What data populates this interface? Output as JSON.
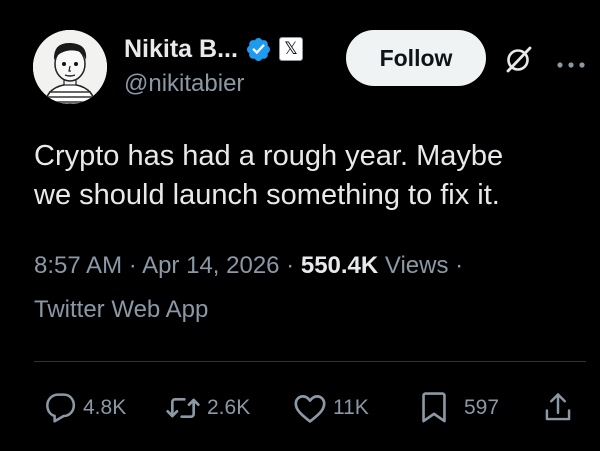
{
  "author": {
    "display_name": "Nikita B...",
    "handle": "@nikitabier",
    "affiliation_badge": "𝕏"
  },
  "follow_button": {
    "label": "Follow"
  },
  "tweet": {
    "line1": "Crypto has had a rough year. Maybe",
    "line2": "we should launch something to fix it."
  },
  "meta": {
    "time": "8:57 AM",
    "separator1": " · ",
    "date": "Apr 14, 2026",
    "separator2": " · ",
    "views_count": "550.4K",
    "views_label": " Views",
    "separator3": " ·",
    "source": "Twitter Web App"
  },
  "actions": {
    "replies": "4.8K",
    "reposts": "2.6K",
    "likes": "11K",
    "bookmarks": "597"
  },
  "colors": {
    "background": "#000000",
    "primary_text": "#e7e9ea",
    "secondary_text": "#8b98a5",
    "verified_blue": "#1d9bf0",
    "follow_bg": "#eff3f4"
  },
  "icons": [
    "avatar",
    "verified-badge-icon",
    "x-affiliation-icon",
    "grok-icon",
    "more-icon",
    "reply-icon",
    "repost-icon",
    "like-icon",
    "bookmark-icon",
    "share-icon"
  ]
}
